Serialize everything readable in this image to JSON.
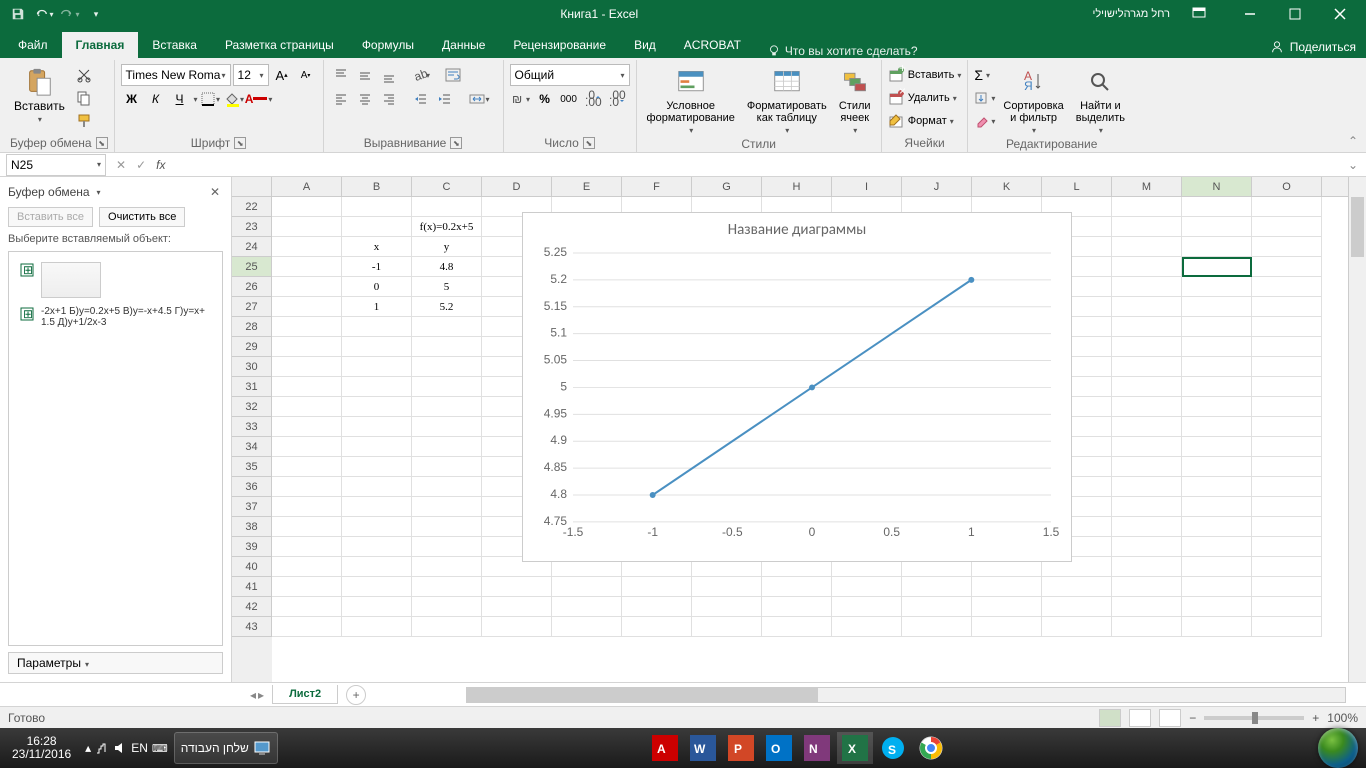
{
  "title": "Книга1  -  Excel",
  "user": "רחל מגרהלישוילי",
  "tabs": {
    "file": "Файл",
    "home": "Главная",
    "insert": "Вставка",
    "layout": "Разметка страницы",
    "formulas": "Формулы",
    "data": "Данные",
    "review": "Рецензирование",
    "view": "Вид",
    "acrobat": "ACROBAT"
  },
  "tellme": "Что вы хотите сделать?",
  "share": "Поделиться",
  "ribbon": {
    "clipboard": {
      "paste": "Вставить",
      "label": "Буфер обмена"
    },
    "font": {
      "name": "Times New Roma",
      "size": "12",
      "label": "Шрифт",
      "bold": "Ж",
      "italic": "К",
      "underline": "Ч"
    },
    "align": {
      "label": "Выравнивание"
    },
    "number": {
      "format": "Общий",
      "label": "Число"
    },
    "styles": {
      "cond": "Условное\nформатирование",
      "table": "Форматировать\nкак таблицу",
      "cell": "Стили\nячеек",
      "label": "Стили"
    },
    "cells": {
      "insert": "Вставить",
      "delete": "Удалить",
      "format": "Формат",
      "label": "Ячейки"
    },
    "editing": {
      "sort": "Сортировка\nи фильтр",
      "find": "Найти и\nвыделить",
      "label": "Редактирование"
    }
  },
  "namebox": "N25",
  "clipboard_pane": {
    "title": "Буфер обмена",
    "paste_all": "Вставить все",
    "clear_all": "Очистить все",
    "hint": "Выберите вставляемый объект:",
    "item_text": "-2x+1 Б)y=0.2x+5 В)y=-x+4.5 Г)y=x+1.5 Д)y+1/2x-3",
    "params": "Параметры"
  },
  "columns": [
    "A",
    "B",
    "C",
    "D",
    "E",
    "F",
    "G",
    "H",
    "I",
    "J",
    "K",
    "L",
    "M",
    "N",
    "O"
  ],
  "rows": [
    22,
    23,
    24,
    25,
    26,
    27,
    28,
    29,
    30,
    31,
    32,
    33,
    34,
    35,
    36,
    37,
    38,
    39,
    40,
    41,
    42,
    43
  ],
  "selected_col_idx": 13,
  "selected_row_idx": 3,
  "cell_data": {
    "23": {
      "C": "f(x)=0.2x+5"
    },
    "24": {
      "B": "x",
      "C": "y"
    },
    "25": {
      "B": "-1",
      "C": "4.8"
    },
    "26": {
      "B": "0",
      "C": "5"
    },
    "27": {
      "B": "1",
      "C": "5.2"
    }
  },
  "chart_data": {
    "type": "line",
    "title": "Название диаграммы",
    "x": [
      -1,
      0,
      1
    ],
    "y": [
      4.8,
      5,
      5.2
    ],
    "xlim": [
      -1.5,
      1.5
    ],
    "ylim": [
      4.75,
      5.25
    ],
    "xticks": [
      -1.5,
      -1,
      -0.5,
      0,
      0.5,
      1,
      1.5
    ],
    "yticks": [
      4.75,
      4.8,
      4.85,
      4.9,
      4.95,
      5,
      5.05,
      5.1,
      5.15,
      5.2,
      5.25
    ]
  },
  "sheet": "Лист2",
  "status": "Готово",
  "zoom": "100%",
  "task": {
    "time": "16:28",
    "date": "23/11/2016",
    "lang": "EN",
    "desktop": "שלחן העבודה"
  }
}
